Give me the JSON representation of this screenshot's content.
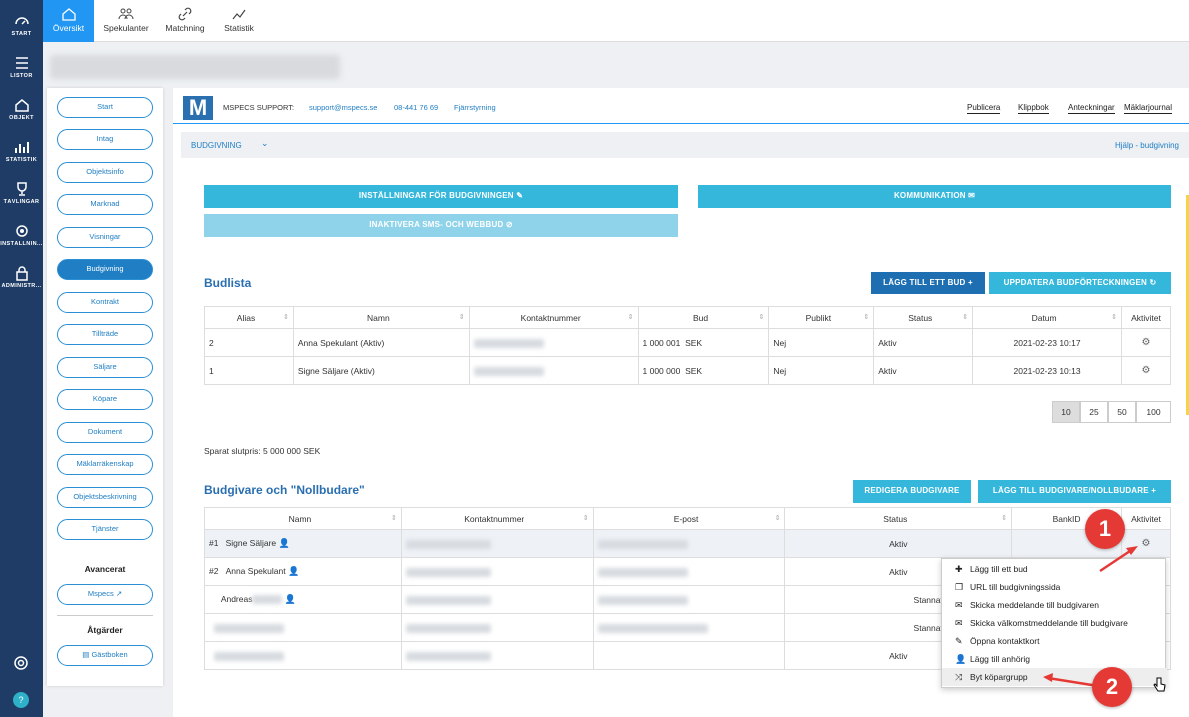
{
  "leftnav": [
    {
      "label": "START",
      "icon": "dashboard-icon"
    },
    {
      "label": "LISTOR",
      "icon": "list-icon"
    },
    {
      "label": "OBJEKT",
      "icon": "house-icon"
    },
    {
      "label": "STATISTIK",
      "icon": "chart-icon"
    },
    {
      "label": "TÄVLINGAR",
      "icon": "trophy-icon"
    },
    {
      "label": "INSTÄLLNIN...",
      "icon": "gear-icon"
    },
    {
      "label": "ADMINISTR...",
      "icon": "lock-icon"
    }
  ],
  "top_tabs": [
    {
      "label": "Översikt",
      "icon": "home-icon",
      "active": true
    },
    {
      "label": "Spekulanter",
      "icon": "people-icon"
    },
    {
      "label": "Matchning",
      "icon": "link-icon"
    },
    {
      "label": "Statistik",
      "icon": "chart-icon"
    }
  ],
  "side_menu": [
    "Start",
    "Intag",
    "Objektsinfo",
    "Marknad",
    "Visningar",
    "Budgivning",
    "Kontrakt",
    "Tillträde",
    "Säljare",
    "Köpare",
    "Dokument",
    "Mäklarräkenskap",
    "Objektsbeskrivning",
    "Tjänster"
  ],
  "side_active": "Budgivning",
  "advanced": {
    "title": "Avancerat",
    "mspecs": "Mspecs"
  },
  "actions": {
    "title": "Åtgärder",
    "guestbook": "Gästboken"
  },
  "header": {
    "logo": "M",
    "support_label": "MSPECS SUPPORT:",
    "email": "support@mspecs.se",
    "phone": "08-441 76 69",
    "remote": "Fjärrstyrning",
    "links": [
      "Publicera",
      "Klippbok",
      "Anteckningar",
      "Mäklarjournal"
    ]
  },
  "subheader": {
    "title": "BUDGIVNING",
    "help": "Hjälp - budgivning"
  },
  "buttons": {
    "settings": "INSTÄLLNINGAR FÖR BUDGIVNINGEN",
    "communication": "KOMMUNIKATION",
    "deactivate": "INAKTIVERA SMS- OCH WEBBUD",
    "add_bid": "LÄGG TILL ETT BUD",
    "update_bids": "UPPDATERA BUDFÖRTECKNINGEN",
    "edit_bidders": "REDIGERA BUDGIVARE",
    "add_bidder": "LÄGG TILL BUDGIVARE/NOLLBUDARE"
  },
  "bidlist": {
    "title": "Budlista",
    "columns": [
      "Alias",
      "Namn",
      "Kontaktnummer",
      "Bud",
      "Publikt",
      "Status",
      "Datum",
      "Aktivitet"
    ],
    "rows": [
      {
        "alias": "2",
        "name": "Anna Spekulant (Aktiv)",
        "bid": "1 000 001",
        "currency": "SEK",
        "public": "Nej",
        "status": "Aktiv",
        "date": "2021-02-23 10:17"
      },
      {
        "alias": "1",
        "name": "Signe Säljare (Aktiv)",
        "bid": "1 000 000",
        "currency": "SEK",
        "public": "Nej",
        "status": "Aktiv",
        "date": "2021-02-23 10:13"
      }
    ],
    "page_sizes": [
      "10",
      "25",
      "50",
      "100"
    ],
    "saved_price": "Sparat slutpris: 5 000 000  SEK"
  },
  "bidders": {
    "title": "Budgivare och \"Nollbudare\"",
    "columns": [
      "Namn",
      "Kontaktnummer",
      "E-post",
      "Status",
      "BankID",
      "Aktivitet"
    ],
    "rows": [
      {
        "num": "#1",
        "name": "Signe Säljare",
        "status": "Aktiv"
      },
      {
        "num": "#2",
        "name": "Anna Spekulant",
        "status": "Aktiv"
      },
      {
        "num": "",
        "name": "Andreas",
        "status": "Stannat, fortsätter få bud"
      },
      {
        "num": "",
        "name": "",
        "status": "Stannat, fortsätter få bud"
      },
      {
        "num": "",
        "name": "",
        "status": "Aktiv"
      }
    ]
  },
  "context_menu": [
    {
      "label": "Lägg till ett bud",
      "icon": "plus-icon"
    },
    {
      "label": "URL till budgivningssida",
      "icon": "copy-icon"
    },
    {
      "label": "Skicka meddelande till budgivaren",
      "icon": "envelope-icon"
    },
    {
      "label": "Skicka välkomstmeddelande till budgivare",
      "icon": "envelope-icon"
    },
    {
      "label": "Öppna kontaktkort",
      "icon": "edit-icon"
    },
    {
      "label": "Lägg till anhörig",
      "icon": "add-user-icon"
    },
    {
      "label": "Byt köpargrupp",
      "icon": "shuffle-icon"
    }
  ],
  "annotations": [
    "1",
    "2"
  ],
  "colors": {
    "nav": "#1e3c66",
    "accent": "#2196f3",
    "light_button": "#35b7dc",
    "dark_button": "#1d6fb2",
    "badge": "#e53935"
  }
}
